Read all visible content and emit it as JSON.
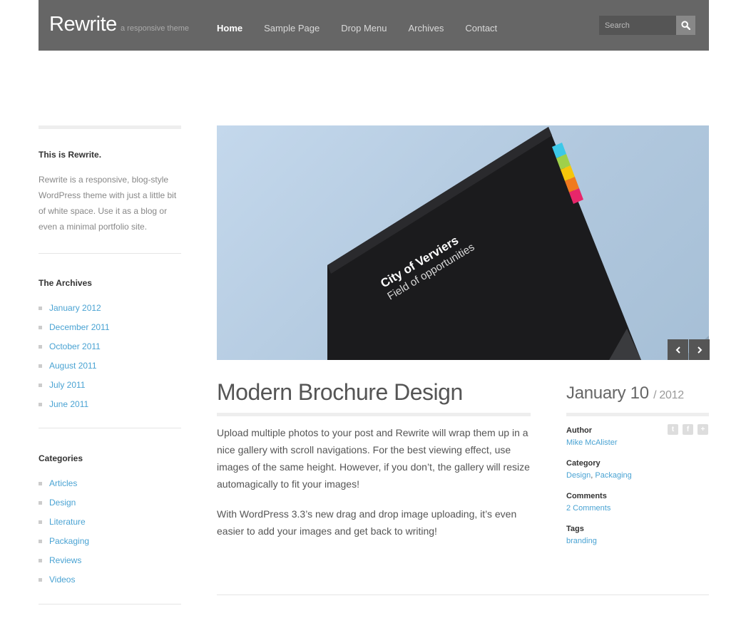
{
  "header": {
    "logo": "Rewrite",
    "tagline": "a responsive theme",
    "nav": [
      "Home",
      "Sample Page",
      "Drop Menu",
      "Archives",
      "Contact"
    ],
    "search_placeholder": "Search"
  },
  "sidebar": {
    "about_title": "This is Rewrite.",
    "about_text": "Rewrite is a responsive, blog-style WordPress theme with just a little bit of white space. Use it as a blog or even a minimal portfolio site.",
    "archives_title": "The Archives",
    "archives": [
      "January 2012",
      "December 2011",
      "October 2011",
      "August 2011",
      "July 2011",
      "June 2011"
    ],
    "categories_title": "Categories",
    "categories": [
      "Articles",
      "Design",
      "Literature",
      "Packaging",
      "Reviews",
      "Videos"
    ]
  },
  "slider": {
    "brochure_line1": "City of Verviers",
    "brochure_line2": "Field of opportunities"
  },
  "post": {
    "title": "Modern Brochure Design",
    "paragraph1": "Upload multiple photos to your post and Rewrite will wrap them up in a nice gallery with scroll navigations. For the best viewing effect, use images of the same height. However, if you don’t, the gallery will resize automagically to fit your images!",
    "paragraph2": "With WordPress 3.3’s new drag and drop image uploading, it’s even easier to add your images and get back to writing!",
    "date": "January 10",
    "year": "/ 2012",
    "author_label": "Author",
    "author": "Mike McAlister",
    "category_label": "Category",
    "category1": "Design",
    "category_sep": ",",
    "category2": "Packaging",
    "comments_label": "Comments",
    "comments": "2 Comments",
    "tags_label": "Tags",
    "tag": "branding"
  },
  "colors": {
    "header_bg": "#666666",
    "link": "#4aa3d3",
    "brochure_swatches": [
      "#3cc8e8",
      "#9fd04a",
      "#f5c60b",
      "#f07a1e",
      "#e8266a"
    ]
  }
}
